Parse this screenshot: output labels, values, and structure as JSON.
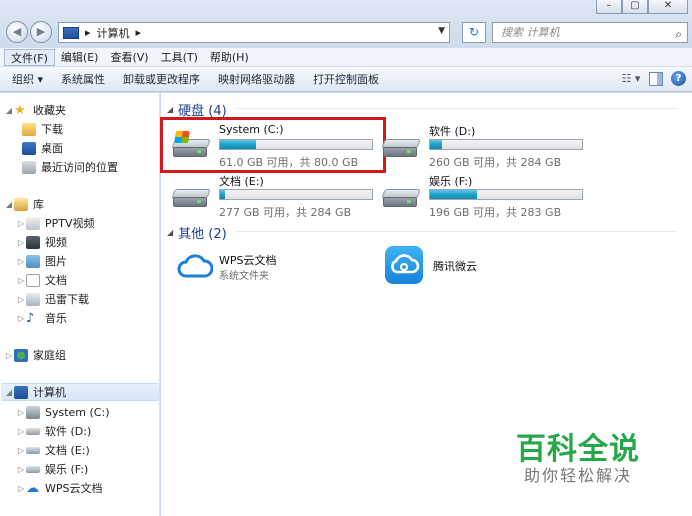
{
  "address": {
    "crumbs": [
      "计算机"
    ],
    "search_placeholder": "搜索 计算机"
  },
  "menu": [
    "文件(F)",
    "编辑(E)",
    "查看(V)",
    "工具(T)",
    "帮助(H)"
  ],
  "toolbar": {
    "organize": "组织 ▾",
    "items": [
      "系统属性",
      "卸载或更改程序",
      "映射网络驱动器",
      "打开控制面板"
    ]
  },
  "sidebar": {
    "favorites": "收藏夹",
    "fav_items": [
      "下载",
      "桌面",
      "最近访问的位置"
    ],
    "library": "库",
    "lib_items": [
      "PPTV视频",
      "视频",
      "图片",
      "文档",
      "迅雷下载",
      "音乐"
    ],
    "homegroup": "家庭组",
    "computer": "计算机",
    "comp_items": [
      "System (C:)",
      "软件 (D:)",
      "文档 (E:)",
      "娱乐 (F:)",
      "WPS云文档"
    ]
  },
  "groups": {
    "hdd": "硬盘 (4)",
    "other": "其他 (2)"
  },
  "drives": [
    {
      "name": "System (C:)",
      "free": "61.0 GB 可用，共 80.0 GB",
      "used_fraction": 0.24
    },
    {
      "name": "软件 (D:)",
      "free": "260 GB 可用，共 284 GB",
      "used_fraction": 0.08
    },
    {
      "name": "文档 (E:)",
      "free": "277 GB 可用，共 284 GB",
      "used_fraction": 0.03
    },
    {
      "name": "娱乐 (F:)",
      "free": "196 GB 可用，共 283 GB",
      "used_fraction": 0.31
    }
  ],
  "others": [
    {
      "name": "WPS云文档",
      "sub": "系统文件夹"
    },
    {
      "name": "腾讯微云",
      "sub": ""
    }
  ],
  "watermark": {
    "big": "百科全说",
    "small": "助你轻松解决"
  }
}
